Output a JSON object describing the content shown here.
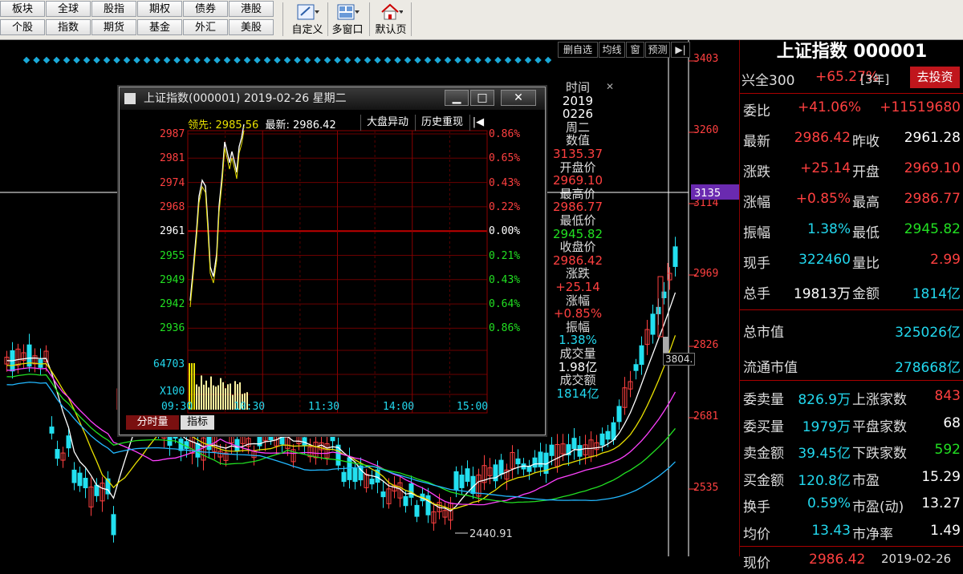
{
  "toolbar": {
    "nav_row1": [
      "板块",
      "全球",
      "股指",
      "期权",
      "债券",
      "港股"
    ],
    "nav_row2": [
      "个股",
      "指数",
      "期货",
      "基金",
      "外汇",
      "美股"
    ],
    "tools": [
      {
        "label": "自定义",
        "icon": "customize-icon"
      },
      {
        "label": "多窗口",
        "icon": "multi-window-icon"
      },
      {
        "label": "默认页",
        "icon": "home-icon"
      }
    ]
  },
  "chart_buttons": [
    "删自选",
    "均线",
    "窗",
    "预测"
  ],
  "price_axis": [
    "3403",
    "3260",
    "3135",
    "3114",
    "2969",
    "2826",
    "2681",
    "2535"
  ],
  "crosshair_label": "3135",
  "min_label": "2440.91",
  "cursor_label": "3804.",
  "right_panel": {
    "title": "上证指数 000001",
    "row_top": {
      "name": "兴全300",
      "pct": "+65.27%",
      "period": "[3年]",
      "button": "去投资"
    },
    "rows": [
      {
        "l1": "委比",
        "v1": "+41.06%",
        "v2": "+11519680"
      },
      {
        "l1": "最新",
        "v1": "2986.42",
        "l2": "昨收",
        "v2": "2961.28"
      },
      {
        "l1": "涨跌",
        "v1": "+25.14",
        "l2": "开盘",
        "v2": "2969.10"
      },
      {
        "l1": "涨幅",
        "v1": "+0.85%",
        "l2": "最高",
        "v2": "2986.77"
      },
      {
        "l1": "振幅",
        "v1": "1.38%",
        "l2": "最低",
        "v2": "2945.82"
      },
      {
        "l1": "现手",
        "v1": "322460",
        "l2": "量比",
        "v2": "2.99"
      },
      {
        "l1": "总手",
        "v1": "19813万",
        "l2": "金额",
        "v2": "1814亿"
      }
    ],
    "cap_rows": [
      {
        "l": "总市值",
        "v": "325026亿"
      },
      {
        "l": "流通市值",
        "v": "278668亿"
      }
    ],
    "stat_rows": [
      {
        "l1": "委卖量",
        "v1": "826.9万",
        "l2": "上涨家数",
        "v2": "843"
      },
      {
        "l1": "委买量",
        "v1": "1979万",
        "l2": "平盘家数",
        "v2": "68"
      },
      {
        "l1": "卖金额",
        "v1": "39.45亿",
        "l2": "下跌家数",
        "v2": "592"
      },
      {
        "l1": "买金额",
        "v1": "120.8亿",
        "l2": "市盈",
        "v2": "15.29"
      },
      {
        "l1": "换手",
        "v1": "0.59%",
        "l2": "市盈(动)",
        "v2": "13.27"
      },
      {
        "l1": "均价",
        "v1": "13.43",
        "l2": "市净率",
        "v2": "1.49"
      }
    ],
    "bottom_partial": {
      "l": "现价",
      "v": "2986.42",
      "d": "2019-02-26"
    }
  },
  "popup": {
    "title": "上证指数(000001) 2019-02-26 星期二",
    "header_lead_label": "领先:",
    "header_lead": "2985.56",
    "header_latest_label": "最新:",
    "header_latest": "2986.42",
    "btn_anomaly": "大盘异动",
    "btn_replay": "历史重现",
    "left_axis": [
      "2987",
      "2981",
      "2974",
      "2968",
      "2961",
      "2955",
      "2949",
      "2942",
      "2936"
    ],
    "right_axis": [
      "0.86%",
      "0.65%",
      "0.43%",
      "0.22%",
      "0.00%",
      "0.21%",
      "0.43%",
      "0.64%",
      "0.86%"
    ],
    "volume_max": "64703",
    "volume_unit": "X100",
    "time_axis": [
      "09:30",
      "10:30",
      "11:30",
      "14:00",
      "15:00"
    ],
    "tabs": [
      "分时量",
      "指标"
    ],
    "info": [
      {
        "t": "时间",
        "c": "lab"
      },
      {
        "t": "2019",
        "c": "white"
      },
      {
        "t": "0226",
        "c": "white"
      },
      {
        "t": "周二",
        "c": "lab"
      },
      {
        "t": "数值",
        "c": "lab"
      },
      {
        "t": "3135.37",
        "c": "red"
      },
      {
        "t": "开盘价",
        "c": "lab"
      },
      {
        "t": "2969.10",
        "c": "red"
      },
      {
        "t": "最高价",
        "c": "lab"
      },
      {
        "t": "2986.77",
        "c": "red"
      },
      {
        "t": "最低价",
        "c": "lab"
      },
      {
        "t": "2945.82",
        "c": "green"
      },
      {
        "t": "收盘价",
        "c": "lab"
      },
      {
        "t": "2986.42",
        "c": "red"
      },
      {
        "t": "涨跌",
        "c": "lab"
      },
      {
        "t": "+25.14",
        "c": "red"
      },
      {
        "t": "涨幅",
        "c": "lab"
      },
      {
        "t": "+0.85%",
        "c": "red"
      },
      {
        "t": "振幅",
        "c": "lab"
      },
      {
        "t": "1.38%",
        "c": "cyan"
      },
      {
        "t": "成交量",
        "c": "lab"
      },
      {
        "t": "1.98亿",
        "c": "white"
      },
      {
        "t": "成交额",
        "c": "lab"
      },
      {
        "t": "1814亿",
        "c": "cyan"
      }
    ]
  },
  "colors": {
    "up": "#ff4040",
    "down": "#22e0f0",
    "bg": "#000000",
    "grid": "#8b0000"
  }
}
